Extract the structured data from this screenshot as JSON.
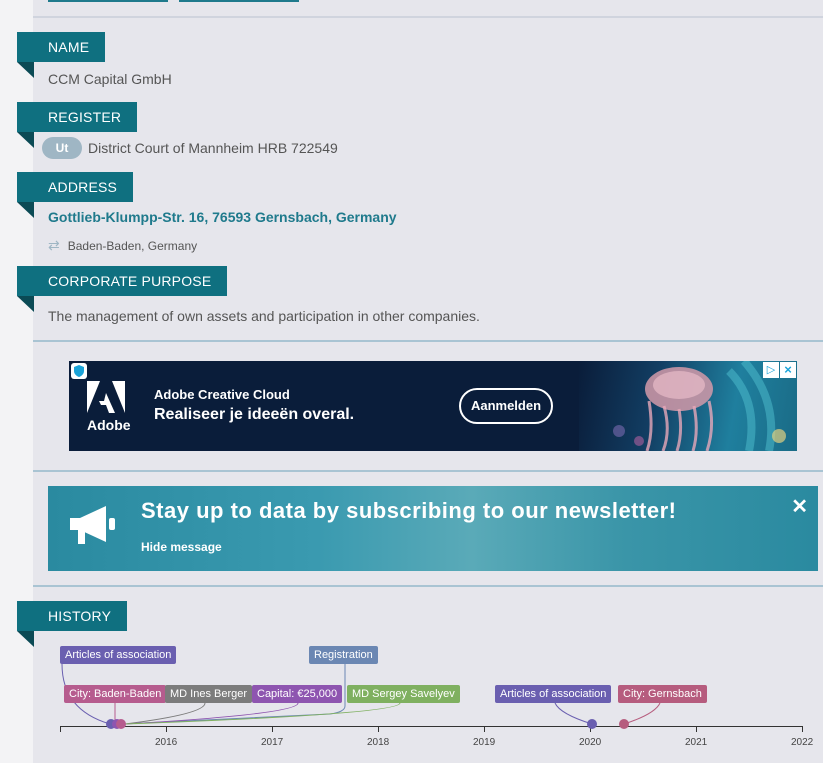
{
  "sections": {
    "name": {
      "label": "NAME",
      "value": "CCM Capital GmbH"
    },
    "register": {
      "label": "REGISTER",
      "badge": "Ut",
      "value": "District Court of Mannheim HRB 722549"
    },
    "address": {
      "label": "ADDRESS",
      "value": "Gottlieb-Klumpp-Str. 16, 76593 Gernsbach, Germany",
      "previous": "Baden-Baden, Germany"
    },
    "purpose": {
      "label": "CORPORATE PURPOSE",
      "value": "The management of own assets and participation in other companies."
    },
    "history": {
      "label": "HISTORY"
    }
  },
  "ad": {
    "brand": "Adobe",
    "title": "Adobe Creative Cloud",
    "headline": "Realiseer je ideeën overal.",
    "cta": "Aanmelden",
    "choices_icon": "play-triangle-icon",
    "close_icon": "close-icon"
  },
  "newsletter": {
    "title": "Stay up to data by subscribing to our newsletter!",
    "hide": "Hide message",
    "close": "✕"
  },
  "timeline": {
    "tags": [
      {
        "text": "Articles of association",
        "color": "#6a5fb0"
      },
      {
        "text": "Registration",
        "color": "#6b87b3"
      },
      {
        "text": "City: Baden-Baden",
        "color": "#b65c8e"
      },
      {
        "text": "MD Ines Berger",
        "color": "#7c7c7c"
      },
      {
        "text": "Capital: €25,000",
        "color": "#8e55b0"
      },
      {
        "text": "MD Sergey Savelyev",
        "color": "#7fb060"
      },
      {
        "text": "Articles of association",
        "color": "#6a5fb0"
      },
      {
        "text": "City: Gernsbach",
        "color": "#b65c7e"
      }
    ],
    "years": [
      "2016",
      "2017",
      "2018",
      "2019",
      "2020",
      "2021",
      "2022"
    ]
  }
}
